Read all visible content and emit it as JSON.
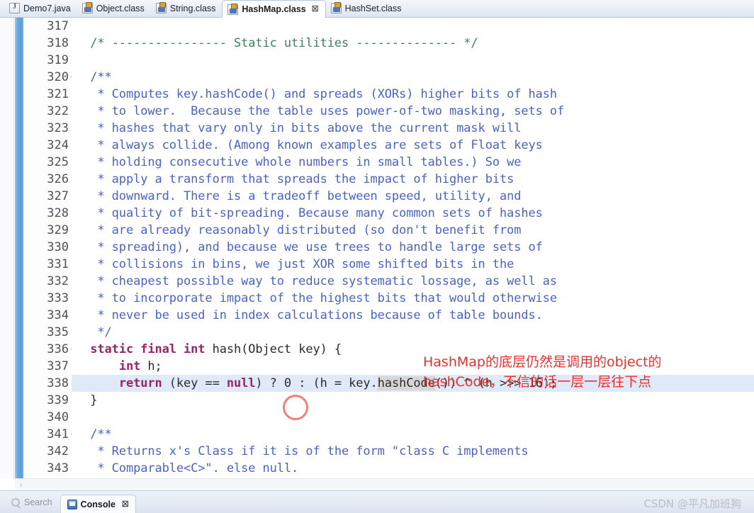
{
  "editor_tabs": [
    {
      "label": "Demo7.java",
      "icon": "java-file-icon",
      "active": false,
      "closable": false
    },
    {
      "label": "Object.class",
      "icon": "class-file-icon",
      "active": false,
      "closable": false
    },
    {
      "label": "String.class",
      "icon": "class-file-icon",
      "active": false,
      "closable": false
    },
    {
      "label": "HashMap.class",
      "icon": "class-file-icon",
      "active": true,
      "closable": true,
      "close_glyph": "☒"
    },
    {
      "label": "HashSet.class",
      "icon": "class-file-icon",
      "active": false,
      "closable": false
    }
  ],
  "gutter": {
    "first_line": 317,
    "fold_glyph": "⊖",
    "fold_lines": [
      320,
      336,
      341
    ],
    "line_numbers": [
      317,
      318,
      319,
      320,
      321,
      322,
      323,
      324,
      325,
      326,
      327,
      328,
      329,
      330,
      331,
      332,
      333,
      334,
      335,
      336,
      337,
      338,
      339,
      340,
      341,
      342,
      343
    ]
  },
  "code": {
    "current_line": 338,
    "lines": [
      {
        "n": 317,
        "segments": []
      },
      {
        "n": 318,
        "segments": [
          {
            "t": "  /* ---------------- Static utilities -------------- */",
            "c": "c-cmt"
          }
        ]
      },
      {
        "n": 319,
        "segments": []
      },
      {
        "n": 320,
        "segments": [
          {
            "t": "  /**",
            "c": "c-doc"
          }
        ]
      },
      {
        "n": 321,
        "segments": [
          {
            "t": "   * Computes key.hashCode() and spreads (XORs) higher bits of hash",
            "c": "c-doc"
          }
        ]
      },
      {
        "n": 322,
        "segments": [
          {
            "t": "   * to lower.  Because the table uses power-of-two masking, sets of",
            "c": "c-doc"
          }
        ]
      },
      {
        "n": 323,
        "segments": [
          {
            "t": "   * hashes that vary only in bits above the current mask will",
            "c": "c-doc"
          }
        ]
      },
      {
        "n": 324,
        "segments": [
          {
            "t": "   * always collide. (Among known examples are sets of Float keys",
            "c": "c-doc"
          }
        ]
      },
      {
        "n": 325,
        "segments": [
          {
            "t": "   * holding consecutive whole numbers in small tables.) So we",
            "c": "c-doc"
          }
        ]
      },
      {
        "n": 326,
        "segments": [
          {
            "t": "   * apply a transform that spreads the impact of higher bits",
            "c": "c-doc"
          }
        ]
      },
      {
        "n": 327,
        "segments": [
          {
            "t": "   * downward. There is a tradeoff between speed, utility, and",
            "c": "c-doc"
          }
        ]
      },
      {
        "n": 328,
        "segments": [
          {
            "t": "   * quality of bit-spreading. Because many common sets of hashes",
            "c": "c-doc"
          }
        ]
      },
      {
        "n": 329,
        "segments": [
          {
            "t": "   * are already reasonably distributed (so don't benefit from",
            "c": "c-doc"
          }
        ]
      },
      {
        "n": 330,
        "segments": [
          {
            "t": "   * spreading), and because we use trees to handle large sets of",
            "c": "c-doc"
          }
        ]
      },
      {
        "n": 331,
        "segments": [
          {
            "t": "   * collisions in bins, we just XOR some shifted bits in the",
            "c": "c-doc"
          }
        ]
      },
      {
        "n": 332,
        "segments": [
          {
            "t": "   * cheapest possible way to reduce systematic lossage, as well as",
            "c": "c-doc"
          }
        ]
      },
      {
        "n": 333,
        "segments": [
          {
            "t": "   * to incorporate impact of the highest bits that would otherwise",
            "c": "c-doc"
          }
        ]
      },
      {
        "n": 334,
        "segments": [
          {
            "t": "   * never be used in index calculations because of table bounds.",
            "c": "c-doc"
          }
        ]
      },
      {
        "n": 335,
        "segments": [
          {
            "t": "   */",
            "c": "c-doc"
          }
        ]
      },
      {
        "n": 336,
        "segments": [
          {
            "t": "  ",
            "c": "c-txt"
          },
          {
            "t": "static final int",
            "c": "c-kw"
          },
          {
            "t": " hash(Object key) {",
            "c": "c-txt"
          }
        ]
      },
      {
        "n": 337,
        "segments": [
          {
            "t": "      ",
            "c": "c-txt"
          },
          {
            "t": "int",
            "c": "c-kw"
          },
          {
            "t": " h;",
            "c": "c-txt"
          }
        ]
      },
      {
        "n": 338,
        "segments": [
          {
            "t": "      ",
            "c": "c-txt"
          },
          {
            "t": "return",
            "c": "c-kw"
          },
          {
            "t": " (key == ",
            "c": "c-txt"
          },
          {
            "t": "null",
            "c": "c-kw"
          },
          {
            "t": ") ? 0 : (h = key.",
            "c": "c-txt"
          },
          {
            "t": "hashCode",
            "c": "c-txt hl-occ"
          },
          {
            "t": "()) ^ (h >>> 16);",
            "c": "c-txt"
          }
        ]
      },
      {
        "n": 339,
        "segments": [
          {
            "t": "  }",
            "c": "c-txt"
          }
        ]
      },
      {
        "n": 340,
        "segments": []
      },
      {
        "n": 341,
        "segments": [
          {
            "t": "  /**",
            "c": "c-doc"
          }
        ]
      },
      {
        "n": 342,
        "segments": [
          {
            "t": "   * Returns x's Class if it is of the form \"class C implements",
            "c": "c-doc"
          }
        ]
      },
      {
        "n": 343,
        "segments": [
          {
            "t": "   * Comparable<C>\". else null.",
            "c": "c-doc"
          }
        ]
      }
    ]
  },
  "annotation": {
    "line1": "HashMap的底层仍然是调用的object的",
    "line2": "hashCode，不信的话一层一层往下点",
    "color": "#f22d2d"
  },
  "scrollbar": {
    "left_arrow_glyph": "‹"
  },
  "view_tabs": [
    {
      "label": "Search",
      "icon": "search-icon",
      "active": false,
      "closable": false
    },
    {
      "label": "Console",
      "icon": "console-icon",
      "active": true,
      "closable": true,
      "close_glyph": "☒"
    }
  ],
  "watermark": {
    "text": "CSDN @平凡加班狗"
  },
  "colors": {
    "javadoc": "#4a63c4",
    "comment": "#3f7f5f",
    "keyword": "#9c2368",
    "current_line_bg": "#dfe9f7",
    "occurrence_bg": "#d6d6d6",
    "changebar": "#5a9ed9",
    "annotation_red": "#f22d2d",
    "cursor_circle": "#f06a5e"
  }
}
